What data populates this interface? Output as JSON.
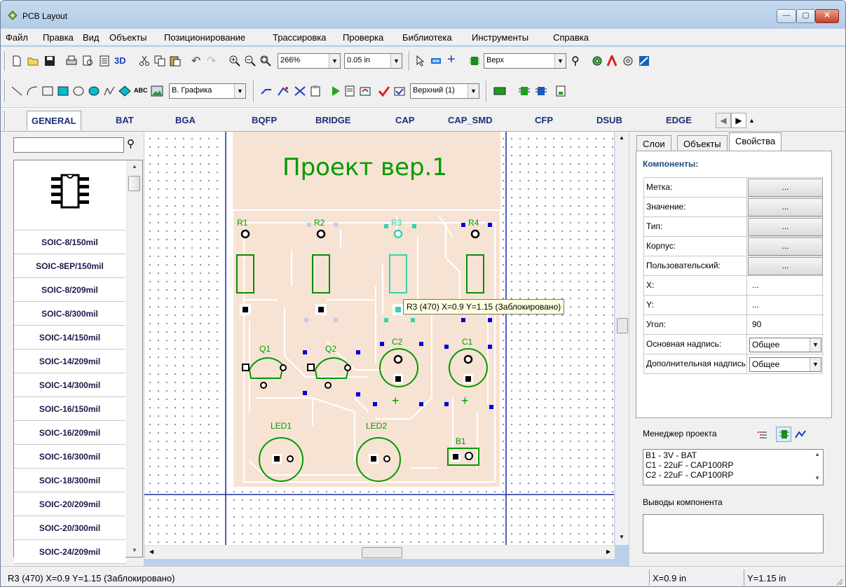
{
  "window": {
    "title": "PCB Layout"
  },
  "menu": [
    "Файл",
    "Правка",
    "Вид",
    "Объекты",
    "Позиционирование",
    "Трассировка",
    "Проверка",
    "Библиотека",
    "Инструменты",
    "Справка"
  ],
  "toolbar1": {
    "zoom": "266%",
    "grid": "0.05 in",
    "layer": "Верх"
  },
  "toolbar2": {
    "graphics_layer": "В. Графика",
    "text_tool": "ABC",
    "layer_select": "Верхний (1)"
  },
  "library_tabs": [
    "GENERAL",
    "BAT",
    "BGA",
    "BQFP",
    "BRIDGE",
    "CAP",
    "CAP_SMD",
    "CFP",
    "DSUB",
    "EDGE"
  ],
  "library_active": "GENERAL",
  "library_search": {
    "value": ""
  },
  "packages": [
    "SOIC-8/150mil",
    "SOIC-8EP/150mil",
    "SOIC-8/209mil",
    "SOIC-8/300mil",
    "SOIC-14/150mil",
    "SOIC-14/209mil",
    "SOIC-14/300mil",
    "SOIC-16/150mil",
    "SOIC-16/209mil",
    "SOIC-16/300mil",
    "SOIC-18/300mil",
    "SOIC-20/209mil",
    "SOIC-20/300mil",
    "SOIC-24/209mil"
  ],
  "board": {
    "title": "Проект вер.1",
    "labels": {
      "r1": "R1",
      "r2": "R2",
      "r3": "R3",
      "r4": "R4",
      "q1": "Q1",
      "q2": "Q2",
      "c2": "C2",
      "c1": "C1",
      "led1": "LED1",
      "led2": "LED2",
      "b1": "B1",
      "plus": "+"
    }
  },
  "tooltip": "R3 (470)  X=0.9  Y=1.15 (Заблокировано)",
  "right_tabs": [
    "Слои",
    "Объекты",
    "Свойства"
  ],
  "right_active": "Свойства",
  "properties": {
    "heading": "Компоненты:",
    "rows": [
      {
        "label": "Метка:",
        "value": "..."
      },
      {
        "label": "Значение:",
        "value": "..."
      },
      {
        "label": "Тип:",
        "value": "..."
      },
      {
        "label": "Корпус:",
        "value": "..."
      },
      {
        "label": "Пользовательский:",
        "value": "..."
      },
      {
        "label": "X:",
        "value": "..."
      },
      {
        "label": "Y:",
        "value": "..."
      },
      {
        "label": "Угол:",
        "value": "90"
      },
      {
        "label": "Основная надпись:",
        "value": "Общее"
      },
      {
        "label": "Дополнительная надпись:",
        "value": "Общее"
      }
    ]
  },
  "project_manager": {
    "title": "Менеджер проекта",
    "items": [
      "B1 - 3V - BAT",
      "C1 - 22uF - CAP100RP",
      "C2 - 22uF - CAP100RP"
    ],
    "pins_title": "Выводы компонента"
  },
  "status": {
    "message": "R3 (470)  X=0.9  Y=1.15 (Заблокировано)",
    "x": "X=0.9 in",
    "y": "Y=1.15 in"
  },
  "colors": {
    "board": "#f7e3d3",
    "outline": "#ffffff",
    "copper": "#008000",
    "silk": "#009b00",
    "selection": "#0000d8",
    "highlight": "#33d2b0",
    "grid_line": "#1a2ea0"
  }
}
